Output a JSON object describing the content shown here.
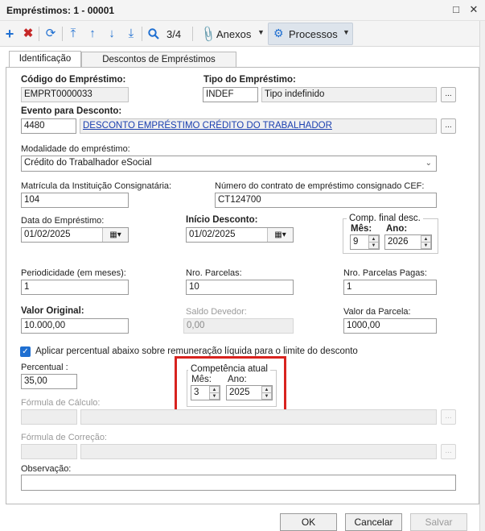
{
  "window": {
    "title": "Empréstimos: 1 - 00001",
    "minimize_icon": "window-minimize-icon",
    "close_icon": "window-close-icon"
  },
  "toolbar": {
    "record_position": "3/4",
    "anexos_label": "Anexos",
    "processos_label": "Processos"
  },
  "tabs": [
    "Identificação",
    "Descontos de Empréstimos"
  ],
  "form": {
    "codigo": {
      "label": "Código do Empréstimo:",
      "value": "EMPRT0000033"
    },
    "tipo": {
      "label": "Tipo do Empréstimo:",
      "code": "INDEF",
      "description": "Tipo indefinido"
    },
    "evento": {
      "label": "Evento para Desconto:",
      "code": "4480",
      "description": "DESCONTO EMPRÉSTIMO CRÉDITO DO TRABALHADOR"
    },
    "modalidade": {
      "label": "Modalidade do empréstimo:",
      "value": "Crédito do Trabalhador eSocial"
    },
    "matricula": {
      "label": "Matrícula da Instituição Consignatária:",
      "value": "104"
    },
    "contrato": {
      "label": "Número do contrato de empréstimo consignado CEF:",
      "value": "CT124700"
    },
    "data_emprestimo": {
      "label": "Data do Empréstimo:",
      "value": "01/02/2025"
    },
    "inicio_desconto": {
      "label": "Início Desconto:",
      "value": "01/02/2025"
    },
    "comp_final": {
      "title": "Comp. final desc.",
      "mes_label": "Mês:",
      "mes_value": "9",
      "ano_label": "Ano:",
      "ano_value": "2026"
    },
    "periodicidade": {
      "label": "Periodicidade (em meses):",
      "value": "1"
    },
    "nro_parcelas": {
      "label": "Nro. Parcelas:",
      "value": "10"
    },
    "nro_parcelas_pagas": {
      "label": "Nro. Parcelas Pagas:",
      "value": "1"
    },
    "valor_original": {
      "label": "Valor Original:",
      "value": "10.000,00"
    },
    "saldo_devedor": {
      "label": "Saldo Devedor:",
      "value": "0,00"
    },
    "valor_parcela": {
      "label": "Valor da Parcela:",
      "value": "1000,00"
    },
    "aplicar_percentual": {
      "label": "Aplicar percentual abaixo sobre remuneração líquida para o limite do desconto",
      "checked": true
    },
    "percentual": {
      "label": "Percentual :",
      "value": "35,00"
    },
    "competencia": {
      "title": "Competência atual",
      "mes_label": "Mês:",
      "mes_value": "3",
      "ano_label": "Ano:",
      "ano_value": "2025"
    },
    "formula_calculo": {
      "label": "Fórmula de Cálculo:"
    },
    "formula_correcao": {
      "label": "Fórmula de Correção:"
    },
    "observacao": {
      "label": "Observação:"
    }
  },
  "buttons": {
    "ok": "OK",
    "cancelar": "Cancelar",
    "salvar": "Salvar"
  },
  "colors": {
    "accent": "#1f6fd1",
    "highlight": "#d8231f",
    "link": "#1a3fb0"
  }
}
